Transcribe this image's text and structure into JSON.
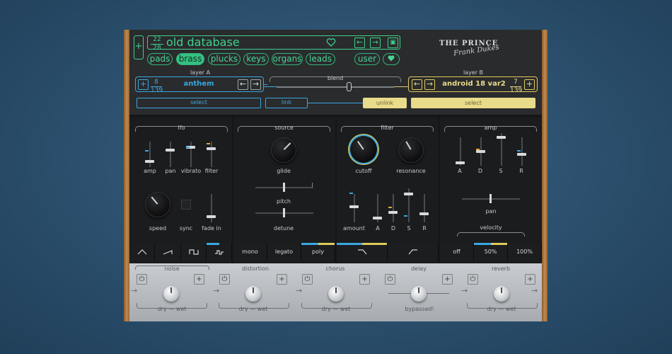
{
  "brand": {
    "name": "THE PRINCE",
    "signature": "Frank Dukes"
  },
  "preset": {
    "index": "22",
    "total": "28",
    "name": "old database"
  },
  "categories": [
    "pads",
    "brass",
    "plucks",
    "keys",
    "organs",
    "leads"
  ],
  "active_category": "brass",
  "user_label": "user",
  "layer_a": {
    "title": "layer A",
    "index": "8",
    "total": "139",
    "name": "anthem",
    "select_label": "select"
  },
  "layer_b": {
    "title": "layer B",
    "index": "7",
    "total": "139",
    "name": "android 18 var2",
    "select_label": "select"
  },
  "blend": {
    "title": "blend",
    "value": 0.5
  },
  "link_label": "link",
  "unlink_label": "unlink",
  "sections": {
    "lfo": "lfo",
    "source": "source",
    "filter": "filter",
    "amp": "amp"
  },
  "lfo": {
    "sliders": [
      "amp",
      "pan",
      "vibrato",
      "filter"
    ],
    "speed": "speed",
    "sync": "sync",
    "fade_in": "fade in"
  },
  "source": {
    "glide": "glide",
    "pitch": "pitch",
    "detune": "detune"
  },
  "filter": {
    "cutoff": "cutoff",
    "resonance": "resonance",
    "env": [
      "amount",
      "A",
      "D",
      "S",
      "R"
    ]
  },
  "amp": {
    "env": [
      "A",
      "D",
      "S",
      "R"
    ],
    "pan": "pan",
    "velocity": "velocity"
  },
  "voice_modes": [
    "mono",
    "legato",
    "poly"
  ],
  "velocity_options": [
    "off",
    "50%",
    "100%"
  ],
  "effects": [
    {
      "name": "noise",
      "footer": "dry — wet"
    },
    {
      "name": "distortion",
      "footer": "dry — wet"
    },
    {
      "name": "chorus",
      "footer": "dry — wet"
    },
    {
      "name": "delay",
      "footer": "bypassed!"
    },
    {
      "name": "reverb",
      "footer": "dry — wet"
    }
  ],
  "colors": {
    "green": "#35c082",
    "blue": "#3aa6e0",
    "yellow": "#e8dc8a",
    "orange": "#e0a83a"
  }
}
